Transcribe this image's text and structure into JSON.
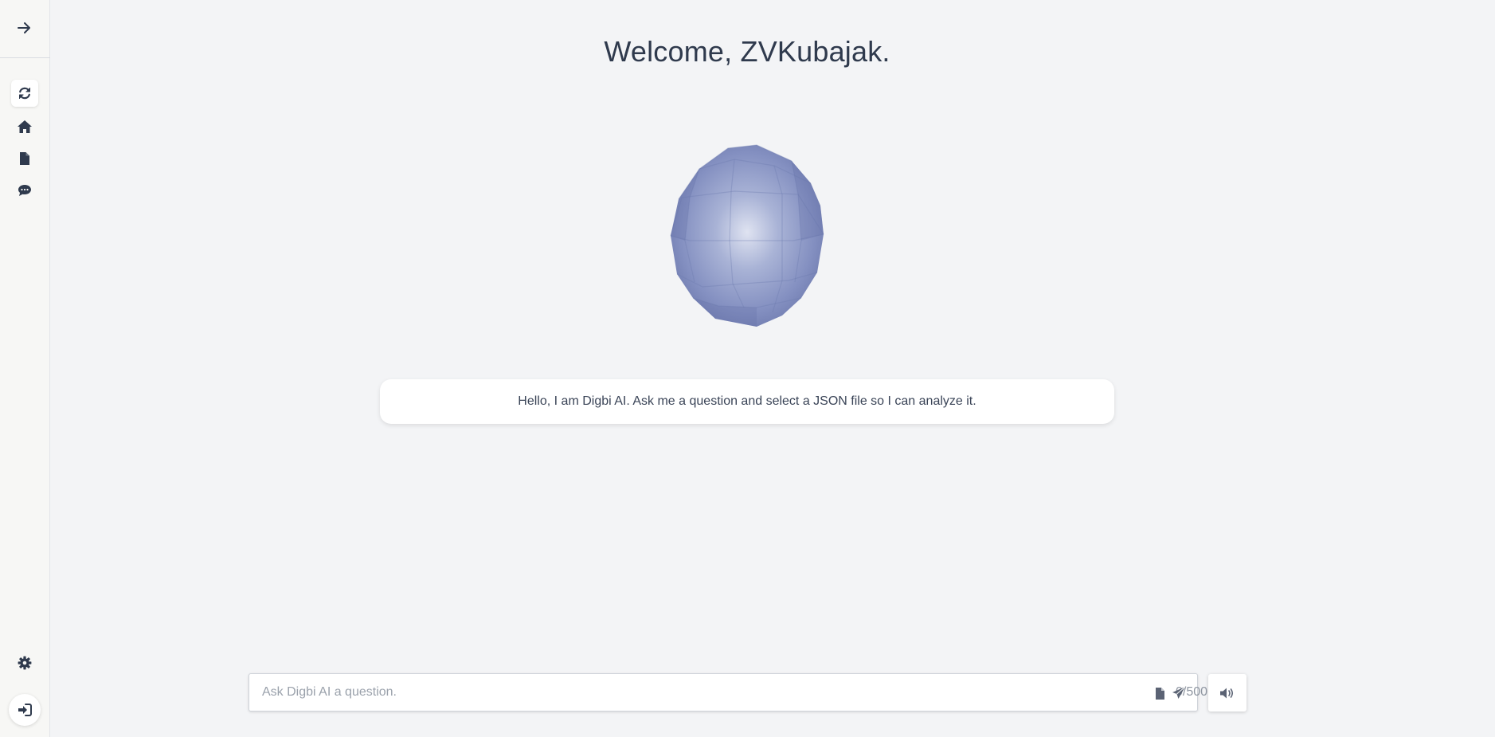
{
  "welcome_title": "Welcome, ZVKubajak.",
  "assistant_message": "Hello, I am Digbi AI. Ask me a question and select a JSON file so I can analyze it.",
  "composer": {
    "placeholder": "Ask Digbi AI a question.",
    "value": "",
    "char_counter": "0/500"
  },
  "sidebar": {
    "top_icon": "arrow-right-icon",
    "items": [
      {
        "icon": "refresh-icon",
        "active": true
      },
      {
        "icon": "home-icon",
        "active": false
      },
      {
        "icon": "file-icon",
        "active": false
      },
      {
        "icon": "chat-icon",
        "active": false
      }
    ],
    "bottom_items": [
      {
        "icon": "gear-icon"
      },
      {
        "icon": "sign-in-icon"
      }
    ]
  },
  "colors": {
    "background": "#f3f4f6",
    "sidebar": "#f7f7f5",
    "text": "#2f3a4d",
    "orb": "#7e8bbd"
  }
}
